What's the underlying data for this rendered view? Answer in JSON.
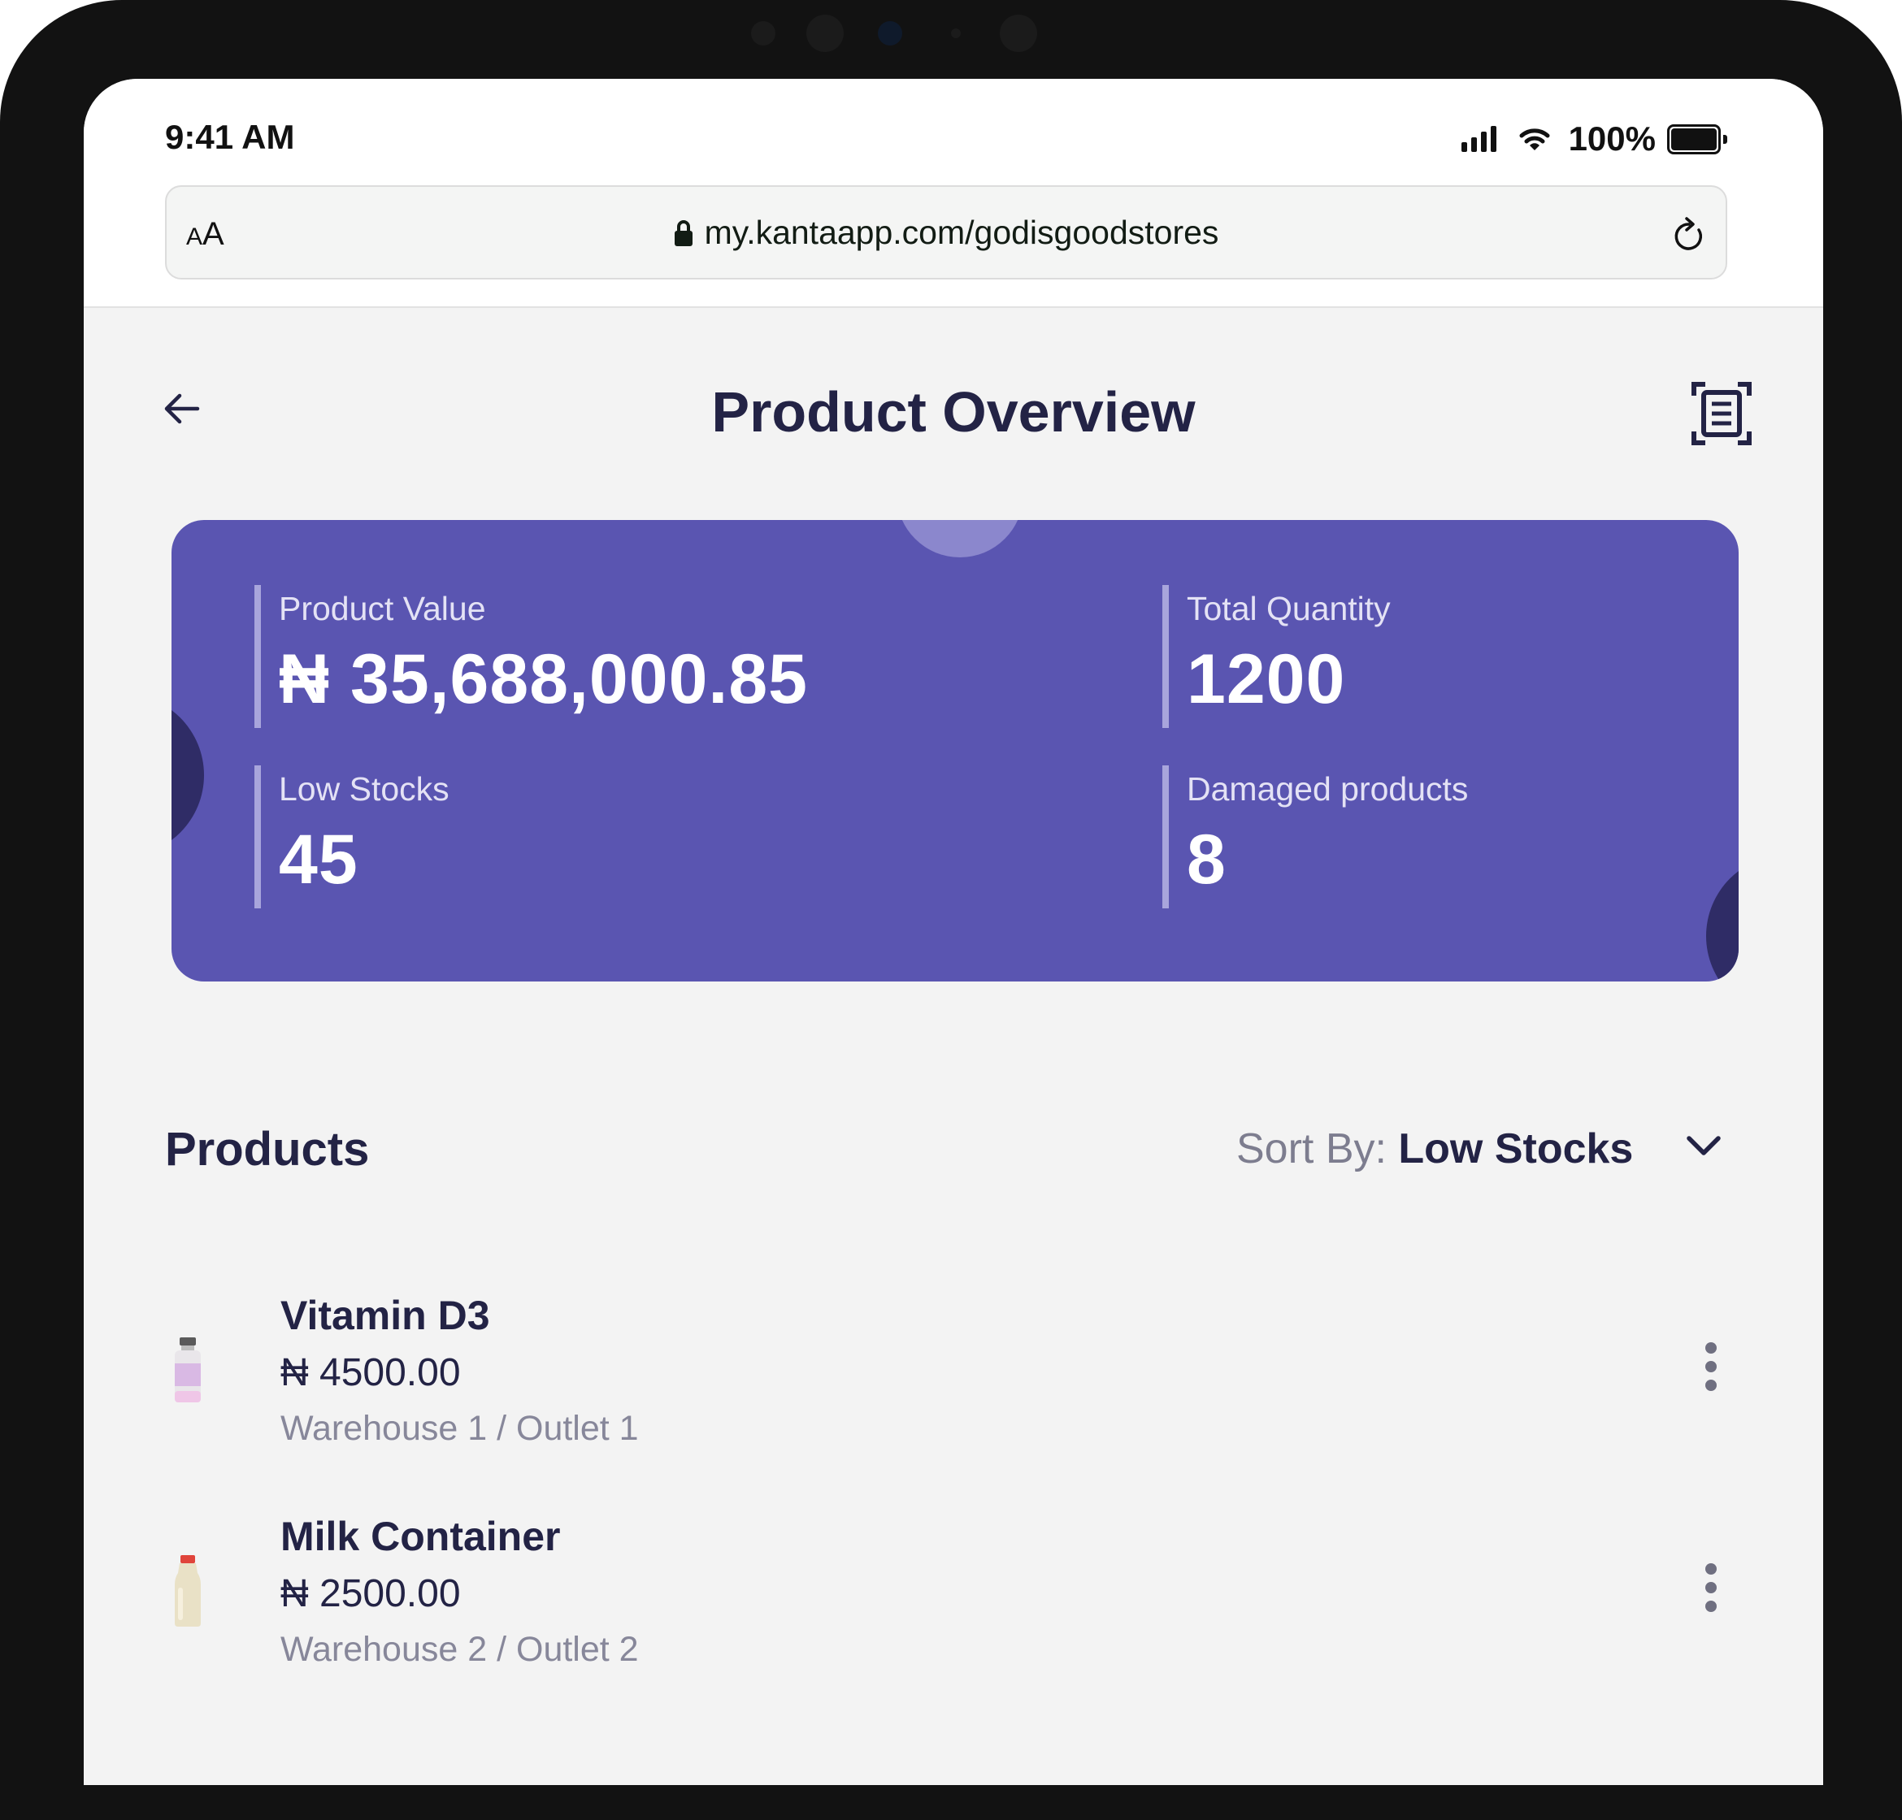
{
  "status_bar": {
    "time": "9:41 AM",
    "battery_percent": "100%"
  },
  "browser": {
    "text_size_small": "A",
    "text_size_large": "A",
    "url": "my.kantaapp.com/godisgoodstores"
  },
  "header": {
    "title": "Product Overview"
  },
  "summary": {
    "product_value_label": "Product Value",
    "product_value": "₦ 35,688,000.85",
    "total_quantity_label": "Total Quantity",
    "total_quantity": "1200",
    "low_stocks_label": "Low Stocks",
    "low_stocks": "45",
    "damaged_label": "Damaged products",
    "damaged": "8"
  },
  "products_section": {
    "title": "Products",
    "sort_prefix": "Sort By: ",
    "sort_value": "Low Stocks"
  },
  "products": [
    {
      "name": "Vitamin D3",
      "price": "₦ 4500.00",
      "location": "Warehouse 1 / Outlet 1"
    },
    {
      "name": "Milk Container",
      "price": "₦ 2500.00",
      "location": "Warehouse 2 / Outlet 2"
    }
  ],
  "colors": {
    "card_background": "#5a55b1",
    "title_text": "#232345",
    "muted_text": "#87879a"
  },
  "icons": {
    "back": "arrow-left-icon",
    "scan": "barcode-scan-icon",
    "sort": "chevron-down-icon",
    "more": "more-vertical-icon"
  }
}
